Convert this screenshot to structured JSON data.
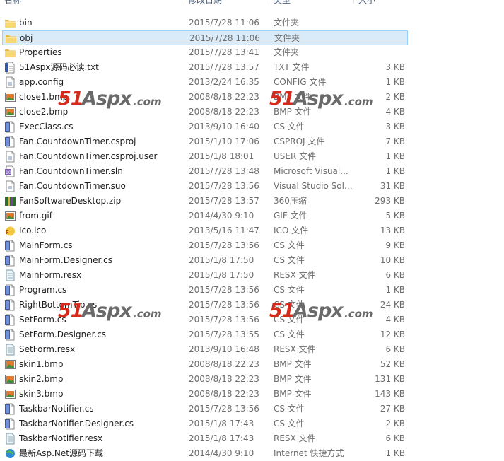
{
  "columns": {
    "name": "名称",
    "date": "修改日期",
    "type": "类型",
    "size": "大小"
  },
  "watermark": {
    "n": "51",
    "a": "Aspx",
    ".com": ".com"
  },
  "colors": {
    "selected_bg": "#d9ebf9",
    "selected_border": "#99d1ff",
    "watermark_red": "#d32a1c"
  },
  "rows": [
    {
      "name": "bin",
      "date": "2015/7/28 11:06",
      "type": "文件夹",
      "size": "",
      "icon": "folder-icon"
    },
    {
      "name": "obj",
      "date": "2015/7/28 11:06",
      "type": "文件夹",
      "size": "",
      "icon": "folder-icon",
      "selected": true
    },
    {
      "name": "Properties",
      "date": "2015/7/28 13:41",
      "type": "文件夹",
      "size": "",
      "icon": "folder-icon"
    },
    {
      "name": "51Aspx源码必读.txt",
      "date": "2015/7/28 13:57",
      "type": "TXT 文件",
      "size": "3 KB",
      "icon": "text-file-icon"
    },
    {
      "name": "app.config",
      "date": "2013/2/24 16:35",
      "type": "CONFIG 文件",
      "size": "1 KB",
      "icon": "config-file-icon"
    },
    {
      "name": "close1.bmp",
      "date": "2008/8/18 22:23",
      "type": "BMP 文件",
      "size": "2 KB",
      "icon": "image-file-icon"
    },
    {
      "name": "close2.bmp",
      "date": "2008/8/18 22:23",
      "type": "BMP 文件",
      "size": "4 KB",
      "icon": "image-file-icon"
    },
    {
      "name": "ExecClass.cs",
      "date": "2013/9/10 16:40",
      "type": "CS 文件",
      "size": "3 KB",
      "icon": "cs-file-icon"
    },
    {
      "name": "Fan.CountdownTimer.csproj",
      "date": "2015/1/10 17:06",
      "type": "CSPROJ 文件",
      "size": "7 KB",
      "icon": "cs-file-icon"
    },
    {
      "name": "Fan.CountdownTimer.csproj.user",
      "date": "2015/1/8 18:01",
      "type": "USER 文件",
      "size": "1 KB",
      "icon": "generic-file-icon"
    },
    {
      "name": "Fan.CountdownTimer.sln",
      "date": "2015/7/28 13:48",
      "type": "Microsoft Visual...",
      "size": "1 KB",
      "icon": "solution-file-icon"
    },
    {
      "name": "Fan.CountdownTimer.suo",
      "date": "2015/7/28 13:56",
      "type": "Visual Studio Sol...",
      "size": "31 KB",
      "icon": "generic-file-icon"
    },
    {
      "name": "FanSoftwareDesktop.zip",
      "date": "2015/7/28 13:57",
      "type": "360压缩",
      "size": "293 KB",
      "icon": "zip-file-icon"
    },
    {
      "name": "from.gif",
      "date": "2014/4/30 9:10",
      "type": "GIF 文件",
      "size": "5 KB",
      "icon": "image-file-icon"
    },
    {
      "name": "Ico.ico",
      "date": "2013/5/16 11:47",
      "type": "ICO 文件",
      "size": "13 KB",
      "icon": "ico-file-icon"
    },
    {
      "name": "MainForm.cs",
      "date": "2015/7/28 13:56",
      "type": "CS 文件",
      "size": "9 KB",
      "icon": "cs-file-icon"
    },
    {
      "name": "MainForm.Designer.cs",
      "date": "2015/1/8 17:50",
      "type": "CS 文件",
      "size": "10 KB",
      "icon": "cs-file-icon"
    },
    {
      "name": "MainForm.resx",
      "date": "2015/1/8 17:50",
      "type": "RESX 文件",
      "size": "6 KB",
      "icon": "resx-file-icon"
    },
    {
      "name": "Program.cs",
      "date": "2015/7/28 13:56",
      "type": "CS 文件",
      "size": "1 KB",
      "icon": "cs-file-icon"
    },
    {
      "name": "RightBottomTip.cs",
      "date": "2015/7/28 13:56",
      "type": "CS 文件",
      "size": "24 KB",
      "icon": "cs-file-icon"
    },
    {
      "name": "SetForm.cs",
      "date": "2015/7/28 13:56",
      "type": "CS 文件",
      "size": "4 KB",
      "icon": "cs-file-icon"
    },
    {
      "name": "SetForm.Designer.cs",
      "date": "2015/7/28 13:55",
      "type": "CS 文件",
      "size": "12 KB",
      "icon": "cs-file-icon"
    },
    {
      "name": "SetForm.resx",
      "date": "2013/9/10 16:48",
      "type": "RESX 文件",
      "size": "6 KB",
      "icon": "resx-file-icon"
    },
    {
      "name": "skin1.bmp",
      "date": "2008/8/18 22:23",
      "type": "BMP 文件",
      "size": "52 KB",
      "icon": "image-file-icon"
    },
    {
      "name": "skin2.bmp",
      "date": "2008/8/18 22:23",
      "type": "BMP 文件",
      "size": "131 KB",
      "icon": "image-file-icon"
    },
    {
      "name": "skin3.bmp",
      "date": "2008/8/18 22:23",
      "type": "BMP 文件",
      "size": "143 KB",
      "icon": "image-file-icon"
    },
    {
      "name": "TaskbarNotifier.cs",
      "date": "2015/7/28 13:56",
      "type": "CS 文件",
      "size": "27 KB",
      "icon": "cs-file-icon"
    },
    {
      "name": "TaskbarNotifier.Designer.cs",
      "date": "2015/1/8 17:43",
      "type": "CS 文件",
      "size": "2 KB",
      "icon": "cs-file-icon"
    },
    {
      "name": "TaskbarNotifier.resx",
      "date": "2015/1/8 17:43",
      "type": "RESX 文件",
      "size": "6 KB",
      "icon": "resx-file-icon"
    },
    {
      "name": "最新Asp.Net源码下载",
      "date": "2014/4/30 9:10",
      "type": "Internet 快捷方式",
      "size": "1 KB",
      "icon": "internet-shortcut-icon"
    }
  ]
}
